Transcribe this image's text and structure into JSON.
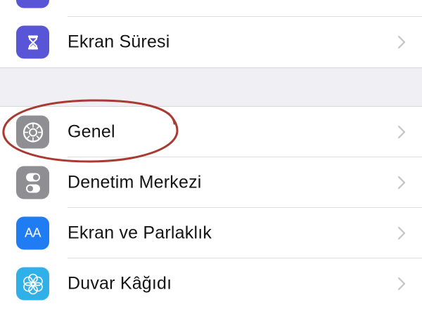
{
  "settings": {
    "rows": [
      {
        "label": "",
        "icon": "partial-icon",
        "color": "#5856d6"
      },
      {
        "label": "Ekran Süresi",
        "icon": "hourglass-icon",
        "color": "#5856d6"
      },
      {
        "label": "Genel",
        "icon": "gear-icon",
        "color": "#8e8e93"
      },
      {
        "label": "Denetim Merkezi",
        "icon": "toggle-switches-icon",
        "color": "#8e8e93"
      },
      {
        "label": "Ekran ve Parlaklık",
        "icon": "text-size-aa-icon",
        "color": "#1f7cf3"
      },
      {
        "label": "Duvar Kâğıdı",
        "icon": "flower-icon",
        "color": "#30b0e8"
      }
    ],
    "aa_glyph": "AA"
  },
  "annotation": {
    "color": "#a83a32",
    "target": "Genel"
  }
}
